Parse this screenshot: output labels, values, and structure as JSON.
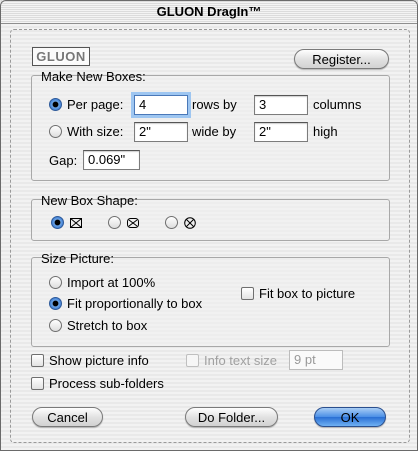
{
  "window": {
    "title": "GLUON DragIn™"
  },
  "logo": {
    "text": "GLUON"
  },
  "buttons": {
    "register": "Register...",
    "cancel": "Cancel",
    "do_folder": "Do Folder...",
    "ok": "OK"
  },
  "make_new_boxes": {
    "title": "Make New Boxes:",
    "per_page_label": "Per page:",
    "rows_value": "4",
    "rows_label": "rows by",
    "columns_value": "3",
    "columns_label": "columns",
    "with_size_label": "With size:",
    "width_value": "2\"",
    "wide_label": "wide by",
    "height_value": "2\"",
    "high_label": "high",
    "gap_label": "Gap:",
    "gap_value": "0.069\"",
    "selected": "per_page"
  },
  "new_box_shape": {
    "title": "New Box Shape:",
    "options": [
      "rectangle-x-icon",
      "rounded-rectangle-x-icon",
      "oval-x-icon"
    ],
    "selected": 0
  },
  "size_picture": {
    "title": "Size Picture:",
    "import_label": "Import at 100%",
    "fit_label": "Fit proportionally to box",
    "stretch_label": "Stretch to box",
    "fit_box_label": "Fit box to picture",
    "selected": "fit"
  },
  "options": {
    "show_info_label": "Show picture info",
    "info_text_size_label": "Info text size",
    "info_text_size_value": "9 pt",
    "process_subfolders_label": "Process sub-folders"
  }
}
